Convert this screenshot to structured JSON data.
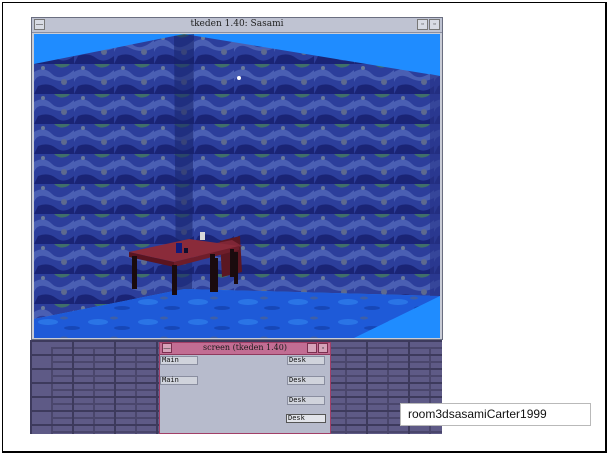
{
  "main_window": {
    "title": "tkeden 1.40: Sasami",
    "minimize_glyph": "—",
    "maximize_glyph": "▫",
    "restore_glyph": "▫"
  },
  "screen_window": {
    "title": "screen (tkeden 1.40)",
    "minimize_glyph": "—",
    "maximize_glyph": "▫",
    "boxes": [
      {
        "label": "Main"
      },
      {
        "label": "Desk"
      },
      {
        "label": "Main"
      },
      {
        "label": "Desk"
      },
      {
        "label": "Desk"
      },
      {
        "label": "Desk"
      }
    ]
  },
  "caption": "room3dsasamiCarter1999",
  "colors": {
    "sky": "#1f8cff",
    "wall_dark": "#1b2a7c",
    "wall_mid": "#3b4ba8",
    "floor": "#1f52d6",
    "table": "#8a2b3a"
  }
}
